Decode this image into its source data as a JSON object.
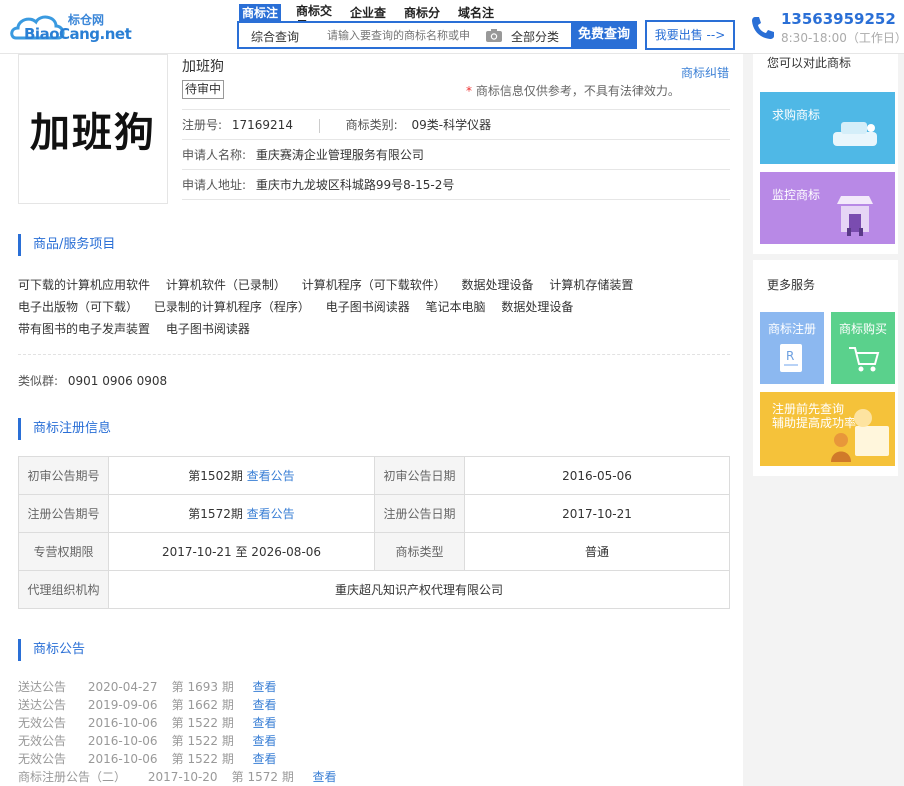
{
  "header": {
    "logo_cn": "标仓网",
    "logo_en": "BiaoCang.net",
    "tabs": [
      "商标注",
      "商标交易",
      "企业查",
      "商标分",
      "域名注"
    ],
    "search_type": "综合查询",
    "search_placeholder": "请输入要查询的商标名称或申",
    "category": "全部分类",
    "search_button": "免费查询",
    "sell_button": "我要出售 -->",
    "phone": "13563959252",
    "hours": "8:30-18:00（工作日）"
  },
  "trademark": {
    "image_text": "加班狗",
    "name": "加班狗",
    "correction_link": "商标纠错",
    "status": "待审中",
    "disclaimer_star": "*",
    "disclaimer": "商标信息仅供参考，不具有法律效力。",
    "reg_no_label": "注册号:",
    "reg_no": "17169214",
    "class_label": "商标类别:",
    "class_value": "09类-科学仪器",
    "applicant_label": "申请人名称:",
    "applicant": "重庆赛涛企业管理服务有限公司",
    "address_label": "申请人地址:",
    "address": "重庆市九龙坡区科城路99号8-15-2号"
  },
  "goods_section": {
    "title": "商品/服务项目",
    "lines": [
      [
        "可下载的计算机应用软件",
        "计算机软件（已录制）",
        "计算机程序（可下载软件）",
        "数据处理设备",
        "计算机存储装置"
      ],
      [
        "电子出版物（可下载）",
        "已录制的计算机程序（程序）",
        "电子图书阅读器",
        "笔记本电脑",
        "数据处理设备"
      ],
      [
        "带有图书的电子发声装置",
        "电子图书阅读器"
      ]
    ],
    "similar_label": "类似群:",
    "similar_groups": "0901 0906 0908"
  },
  "reg_section": {
    "title": "商标注册信息",
    "rows": [
      {
        "l1": "初审公告期号",
        "v1": "第1502期",
        "v1_link": "查看公告",
        "l2": "初审公告日期",
        "v2": "2016-05-06"
      },
      {
        "l1": "注册公告期号",
        "v1": "第1572期",
        "v1_link": "查看公告",
        "l2": "注册公告日期",
        "v2": "2017-10-21"
      },
      {
        "l1": "专营权期限",
        "v1": "2017-10-21 至 2026-08-06",
        "v1_link": "",
        "l2": "商标类型",
        "v2": "普通"
      }
    ],
    "agent_label": "代理组织机构",
    "agent": "重庆超凡知识产权代理有限公司"
  },
  "notice_section": {
    "title": "商标公告",
    "rows": [
      {
        "type": "送达公告",
        "date": "2020-04-27",
        "issue": "第 1693 期",
        "link": "查看"
      },
      {
        "type": "送达公告",
        "date": "2019-09-06",
        "issue": "第 1662 期",
        "link": "查看"
      },
      {
        "type": "无效公告",
        "date": "2016-10-06",
        "issue": "第 1522 期",
        "link": "查看"
      },
      {
        "type": "无效公告",
        "date": "2016-10-06",
        "issue": "第 1522 期",
        "link": "查看"
      },
      {
        "type": "无效公告",
        "date": "2016-10-06",
        "issue": "第 1522 期",
        "link": "查看"
      },
      {
        "type": "商标注册公告（二）",
        "date": "2017-10-20",
        "issue": "第 1572 期",
        "link": "查看"
      }
    ]
  },
  "sidebar": {
    "compare_title": "您可以对此商标",
    "buy_promo": "求购商标",
    "monitor_promo": "监控商标",
    "more_title": "更多服务",
    "register_tile": "商标注册",
    "purchase_tile": "商标购买",
    "banner_line1": "注册前先查询",
    "banner_line2": "辅助提高成功率",
    "colors": {
      "buy": "#4fb8e6",
      "monitor": "#b889e6",
      "register": "#8cb8f0",
      "purchase": "#5ad18c",
      "banner": "#f5c23a"
    }
  }
}
